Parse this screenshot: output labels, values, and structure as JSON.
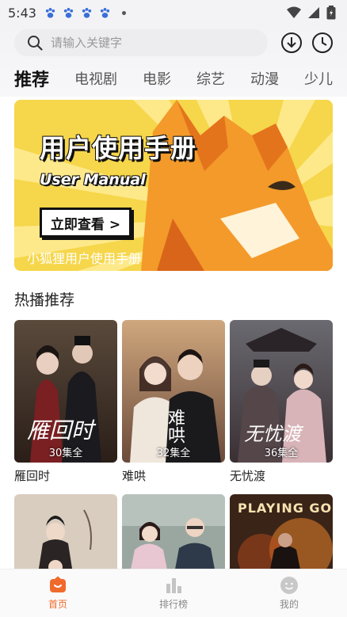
{
  "status_bar": {
    "time": "5:43"
  },
  "search": {
    "placeholder": "请输入关键字"
  },
  "tabs": [
    "推荐",
    "电视剧",
    "电影",
    "综艺",
    "动漫",
    "少儿"
  ],
  "banner": {
    "title": "用户使用手册",
    "subtitle": "User Manual",
    "button": "立即查看 >",
    "caption": "小狐狸用户使用手册"
  },
  "section": {
    "title": "热播推荐"
  },
  "cards": [
    {
      "title": "雁回时",
      "episodes": "30集全",
      "poster_text": "雁回时"
    },
    {
      "title": "难哄",
      "episodes": "32集全",
      "poster_text": "难哄"
    },
    {
      "title": "无忧渡",
      "episodes": "36集全",
      "poster_text": "无忧渡"
    }
  ],
  "cards_row2": [
    {
      "poster_text": ""
    },
    {
      "poster_text": ""
    },
    {
      "poster_text": "PLAYING GO"
    }
  ],
  "nav": [
    {
      "label": "首页",
      "icon": "home-icon",
      "active": true
    },
    {
      "label": "排行榜",
      "icon": "ranking-icon",
      "active": false
    },
    {
      "label": "我的",
      "icon": "profile-icon",
      "active": false
    }
  ],
  "colors": {
    "accent": "#f06a2c",
    "banner_bg": "#f6d64a"
  }
}
